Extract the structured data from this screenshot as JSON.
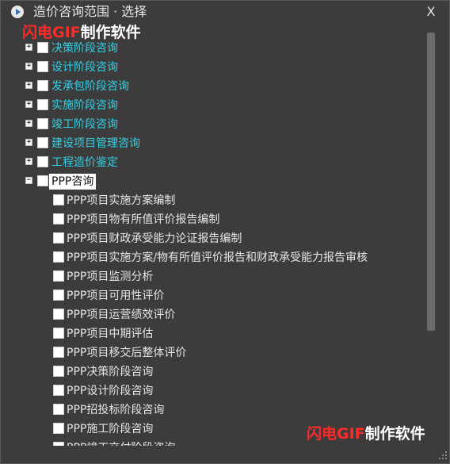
{
  "window": {
    "title": "造价咨询范围 · 选择",
    "close_label": "X"
  },
  "watermark": {
    "red": "闪电GIF",
    "white": "制作软件"
  },
  "tree": {
    "top_items": [
      {
        "label": "决策阶段咨询",
        "expander": "+"
      },
      {
        "label": "设计阶段咨询",
        "expander": "+"
      },
      {
        "label": "发承包阶段咨询",
        "expander": "+"
      },
      {
        "label": "实施阶段咨询",
        "expander": "+"
      },
      {
        "label": "竣工阶段咨询",
        "expander": "+"
      },
      {
        "label": "建设项目管理咨询",
        "expander": "+"
      },
      {
        "label": "工程造价鉴定",
        "expander": "+"
      },
      {
        "label": "PPP咨询",
        "expander": "−"
      }
    ],
    "ppp_children": [
      "PPP项目实施方案编制",
      "PPP项目物有所值评价报告编制",
      "PPP项目财政承受能力论证报告编制",
      "PPP项目实施方案/物有所值评价报告和财政承受能力报告审核",
      "PPP项目监测分析",
      "PPP项目可用性评价",
      "PPP项目运营绩效评价",
      "PPP项目中期评估",
      "PPP项目移交后整体评价",
      "PPP决策阶段咨询",
      "PPP设计阶段咨询",
      "PPP招投标阶段咨询",
      "PPP施工阶段咨询",
      "PPP竣工交付阶段咨询"
    ]
  },
  "scrollbar": {
    "position_fraction": 0
  }
}
